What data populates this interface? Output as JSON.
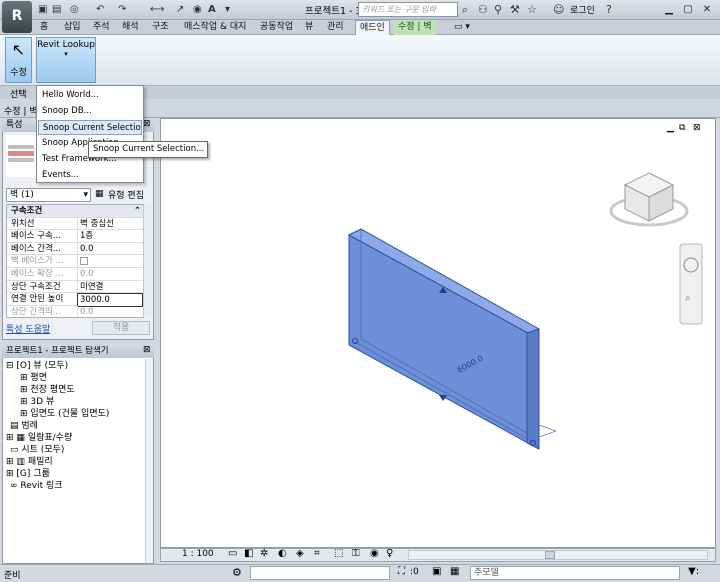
{
  "app": {
    "title": "프로젝트1 - 3...",
    "search_placeholder": "키워드 또는 구문 입력",
    "login_label": "로그인"
  },
  "tabs": [
    {
      "label": "홈"
    },
    {
      "label": "삽입"
    },
    {
      "label": "주석"
    },
    {
      "label": "해석"
    },
    {
      "label": "구조"
    },
    {
      "label": "매스작업 & 대지"
    },
    {
      "label": "공동작업"
    },
    {
      "label": "뷰"
    },
    {
      "label": "관리"
    },
    {
      "label": "애드인"
    },
    {
      "label": "수정 | 벽"
    }
  ],
  "ribbon": {
    "modify_label": "수정",
    "revit_lookup_label": "Revit Lookup",
    "select_panel_label": "선택"
  },
  "options_bar": {
    "text": "수정 | 벽"
  },
  "menu": {
    "items": [
      {
        "label": "Hello World..."
      },
      {
        "label": "Snoop DB..."
      },
      {
        "label": "Snoop Current Selection..."
      },
      {
        "label": "Snoop Application..."
      },
      {
        "label": "Test Framework..."
      },
      {
        "label": "Events..."
      }
    ],
    "tooltip": "Snoop Current Selection..."
  },
  "properties": {
    "title": "특성",
    "type_selector": "벽 (1)",
    "edit_type": "유형 편집",
    "rows": [
      {
        "key": "구속조건",
        "value": ""
      },
      {
        "key": "위치선",
        "value": "벽 중심선"
      },
      {
        "key": "베이스 구속...",
        "value": "1층"
      },
      {
        "key": "베이스 간격...",
        "value": "0.0"
      },
      {
        "key": "벽 베이스가 ...",
        "value": ""
      },
      {
        "key": "베이스 확장 ...",
        "value": "0.0"
      },
      {
        "key": "상단 구속조건",
        "value": "미연결"
      },
      {
        "key": "연결 안된 높이",
        "value": "3000.0"
      },
      {
        "key": "상단 간격띄...",
        "value": "0.0"
      }
    ],
    "help_link": "특성 도움말",
    "apply_label": "적용"
  },
  "browser": {
    "title": "프로젝트1 - 프로젝트 탐색기",
    "items": [
      {
        "label": "뷰 (모두)"
      },
      {
        "label": "평면"
      },
      {
        "label": "천장 평면도"
      },
      {
        "label": "3D 뷰"
      },
      {
        "label": "입면도 (건물 입면도)"
      },
      {
        "label": "범례"
      },
      {
        "label": "일람표/수량"
      },
      {
        "label": "시트 (모두)"
      },
      {
        "label": "패밀리"
      },
      {
        "label": "그룹"
      },
      {
        "label": "Revit 링크"
      }
    ]
  },
  "viewport": {
    "dimension_label": "6000.0",
    "scale": "1 : 100"
  },
  "status": {
    "text": "준비",
    "zero": ":0",
    "model": "주모델"
  },
  "colors": {
    "wall_fill": "#6d8fd8",
    "wall_edge": "#2a4fa8",
    "accent": "#9ccaf0"
  }
}
